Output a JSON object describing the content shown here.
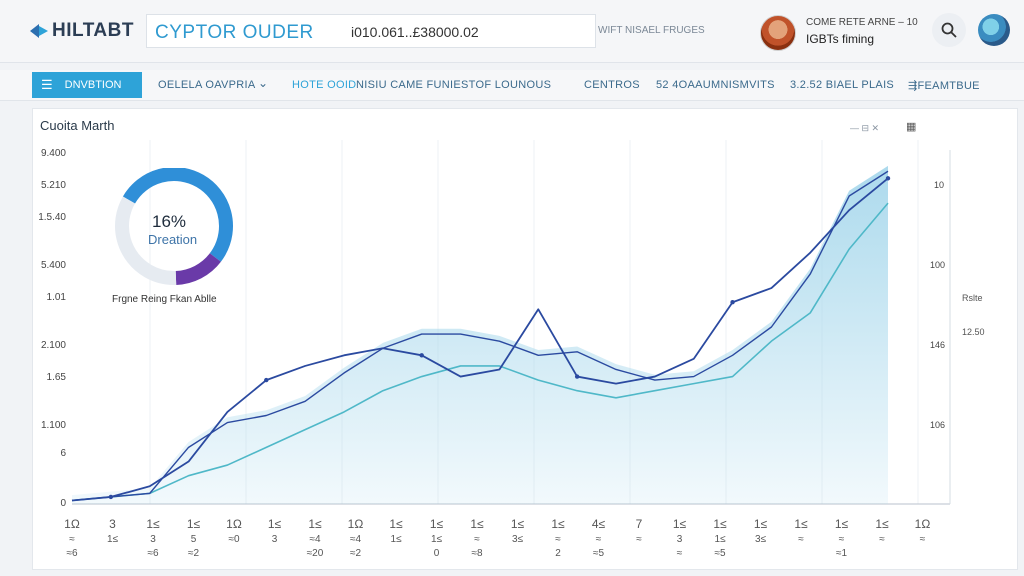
{
  "header": {
    "logo": "HILTABT",
    "brand": "CYPTOR OUDER",
    "search_value": "i010.061..£38000.02",
    "link": "WIFT NISAEL FRUGES",
    "user_name": "COME RETE ARNE – 10",
    "user_sub": "IGBTs fiming"
  },
  "nav": {
    "primary": "DNVBTION",
    "items": [
      "OELELA OAVPRIA",
      "HOTE OOID",
      "NISIU CAME FUNIESTOF LOUNOUS",
      "CENTROS",
      "52 4OAAUMNISMVITS",
      "3.2.52 BIAEL PLAIS",
      "FEAMTBUE"
    ]
  },
  "chart": {
    "title": "Cuoita Marth",
    "actions": "— ⊟ ✕",
    "menu": "▦",
    "y_left_ticks": [
      "9.400",
      "5.210",
      "1.5.40",
      "5.400",
      "1.01",
      "2.100",
      "1.65",
      "1.100",
      "6",
      "0"
    ],
    "y_right_ticks": [
      "10",
      "100",
      "146",
      "106"
    ],
    "donut": {
      "percent": "16%",
      "label": "Dreation",
      "caption": "Frgne Reing Fkan Ablle",
      "segments": [
        {
          "fraction": 0.52,
          "color": "#2f8fd8"
        },
        {
          "fraction": 0.14,
          "color": "#6a3aa8"
        },
        {
          "fraction": 0.34,
          "color": "#e6ebf1"
        }
      ]
    },
    "side_label": "Rslte",
    "side_value": "12.50",
    "colors": {
      "line_dark": "#2b4aa0",
      "line_teal": "#4fb8c8",
      "area_fill": "#a8d8ec",
      "donut_main": "#2f8fd8",
      "donut_accent": "#6a3aa8"
    }
  },
  "chart_data": {
    "type": "line",
    "x": [
      0,
      1,
      2,
      3,
      4,
      5,
      6,
      7,
      8,
      9,
      10,
      11,
      12,
      13,
      14,
      15,
      16,
      17,
      18,
      19,
      20,
      21
    ],
    "series": [
      {
        "values": [
          0.1,
          0.2,
          0.3,
          1.6,
          2.3,
          2.5,
          2.9,
          3.7,
          4.4,
          4.8,
          4.8,
          4.6,
          4.2,
          4.3,
          3.8,
          3.5,
          3.6,
          4.2,
          5.0,
          6.5,
          8.7,
          9.4
        ]
      },
      {
        "values": [
          0.1,
          0.2,
          0.3,
          0.8,
          1.1,
          1.6,
          2.1,
          2.6,
          3.2,
          3.6,
          3.9,
          3.9,
          3.5,
          3.2,
          3.0,
          3.2,
          3.4,
          3.6,
          4.6,
          5.4,
          7.2,
          8.5
        ]
      },
      {
        "values": [
          0.1,
          0.2,
          0.5,
          1.2,
          2.6,
          3.5,
          3.9,
          4.2,
          4.4,
          4.2,
          3.6,
          3.8,
          5.5,
          3.6,
          3.4,
          3.6,
          4.1,
          5.7,
          6.1,
          7.1,
          8.3,
          9.2
        ]
      }
    ],
    "y_ticks": [
      "9.400",
      "5.210",
      "1.5.40",
      "5.400",
      "1.01",
      "2.100",
      "1.65",
      "1.100",
      "6",
      "0"
    ],
    "ylim": [
      0,
      10
    ],
    "x_tick_labels": [
      [
        "1Ω",
        "3",
        "1≤",
        "1≤",
        "1Ω",
        "1≤",
        "1≤",
        "1Ω",
        "1≤",
        "1≤",
        "1≤",
        "1≤",
        "1≤",
        "4≤",
        "7",
        "1≤",
        "1≤",
        "1≤",
        "1≤",
        "1≤",
        "1≤",
        "1Ω"
      ],
      [
        "≈",
        "1≤",
        "3",
        "5",
        "≈0",
        "3",
        "≈4",
        "≈4",
        "1≤",
        "1≤",
        "≈",
        "3≤",
        "≈",
        "≈",
        "≈",
        "3",
        "1≤",
        "3≤",
        "≈",
        "≈",
        "≈",
        "≈"
      ],
      [
        "≈6",
        "",
        "≈6",
        "≈2",
        "",
        "",
        "≈20",
        "≈2",
        "",
        "0",
        "≈8",
        "",
        "2",
        "≈5",
        "",
        "≈",
        "≈5",
        "",
        "",
        "≈1",
        "",
        ""
      ]
    ],
    "grid": true
  }
}
